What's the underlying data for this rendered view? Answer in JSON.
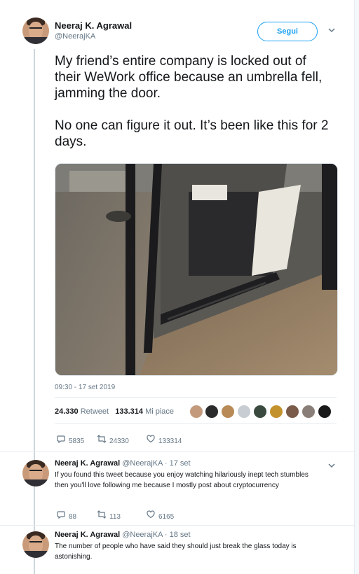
{
  "tweet": {
    "author_name": "Neeraj K. Agrawal",
    "author_handle": "@NeerajKA",
    "follow_label": "Segui",
    "text_p1": "My friend’s entire company is locked out of their WeWork office because an umbrella fell, jamming the door.",
    "text_p2": "No one can figure it out. It’s been like this for 2 days.",
    "timestamp": "09:30 - 17 set 2019",
    "retweets_count": "24.330",
    "retweets_label": "Retweet",
    "likes_count": "133.314",
    "likes_label": "Mi piace",
    "actions": {
      "reply_count": "5835",
      "retweet_count": "24330",
      "like_count": "133314"
    }
  },
  "replies": [
    {
      "author_name": "Neeraj K. Agrawal",
      "meta": "@NeerajKA · 17 set",
      "text": "If you found this tweet because you enjoy watching hilariously inept tech stumbles then you'll love following me because I mostly post about cryptocurrency",
      "reply_count": "88",
      "retweet_count": "113",
      "like_count": "6165"
    },
    {
      "author_name": "Neeraj K. Agrawal",
      "meta": "@NeerajKA · 18 set",
      "text": "The number of people who have said they should just break the glass today is astonishing."
    }
  ],
  "icons": {
    "reply": "reply-icon",
    "retweet": "retweet-icon",
    "like": "heart-icon",
    "more": "chevron-down-icon"
  },
  "colors": {
    "accent": "#1da1f2",
    "muted": "#657786",
    "text": "#14171a"
  }
}
